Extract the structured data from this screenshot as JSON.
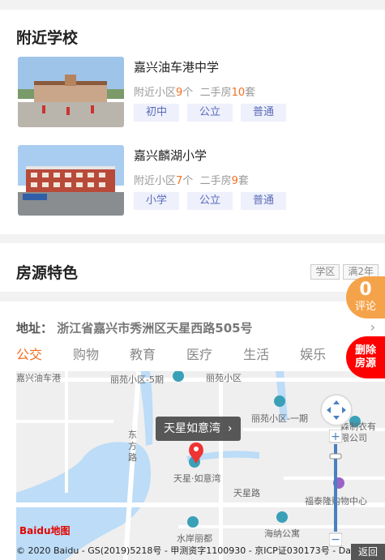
{
  "schools": {
    "title": "附近学校",
    "items": [
      {
        "name": "嘉兴油车港中学",
        "prefix": "附近小区",
        "community_count": "9",
        "community_unit": "个",
        "second_prefix": "二手房",
        "second_count": "10",
        "second_unit": "套",
        "tags": [
          "初中",
          "公立",
          "普通"
        ]
      },
      {
        "name": "嘉兴麟湖小学",
        "prefix": "附近小区",
        "community_count": "7",
        "community_unit": "个",
        "second_prefix": "二手房",
        "second_count": "9",
        "second_unit": "套",
        "tags": [
          "小学",
          "公立",
          "普通"
        ]
      }
    ]
  },
  "features": {
    "title": "房源特色",
    "tags": [
      "学区",
      "满2年"
    ]
  },
  "address": {
    "label": "地址：",
    "value": "浙江省嘉兴市秀洲区天星西路505号",
    "tabs": [
      "公交",
      "购物",
      "教育",
      "医疗",
      "生活",
      "娱乐"
    ]
  },
  "map": {
    "callout": "天星如意湾",
    "labels": {
      "l1": "丽苑小区-5期",
      "l2": "丽苑小区",
      "l3": "丽苑小区-一期",
      "l4": "东方路",
      "l5": "天星·如意湾",
      "l6": "天星路",
      "l7": "福泰隆购物中心",
      "l8": "海纳公寓",
      "l9": "水岸丽都",
      "l10": "森制衣有限公司",
      "l11": "嘉兴油车港"
    },
    "logo": "Baidu地图",
    "copyright": "© 2020 Baidu - GS(2019)5218号 - 甲测资字1100930 - 京ICP证030173号 - Data"
  },
  "floating": {
    "comment_count": "0",
    "comment_label": "评论",
    "delete_label_1": "删除",
    "delete_label_2": "房源",
    "back_label": "返回"
  },
  "colors": {
    "accent": "#f36f20",
    "tag_text": "#5a6bb8",
    "tag_bg": "#eef0fb",
    "delete": "#ff0000",
    "comment": "#f5a34a"
  }
}
